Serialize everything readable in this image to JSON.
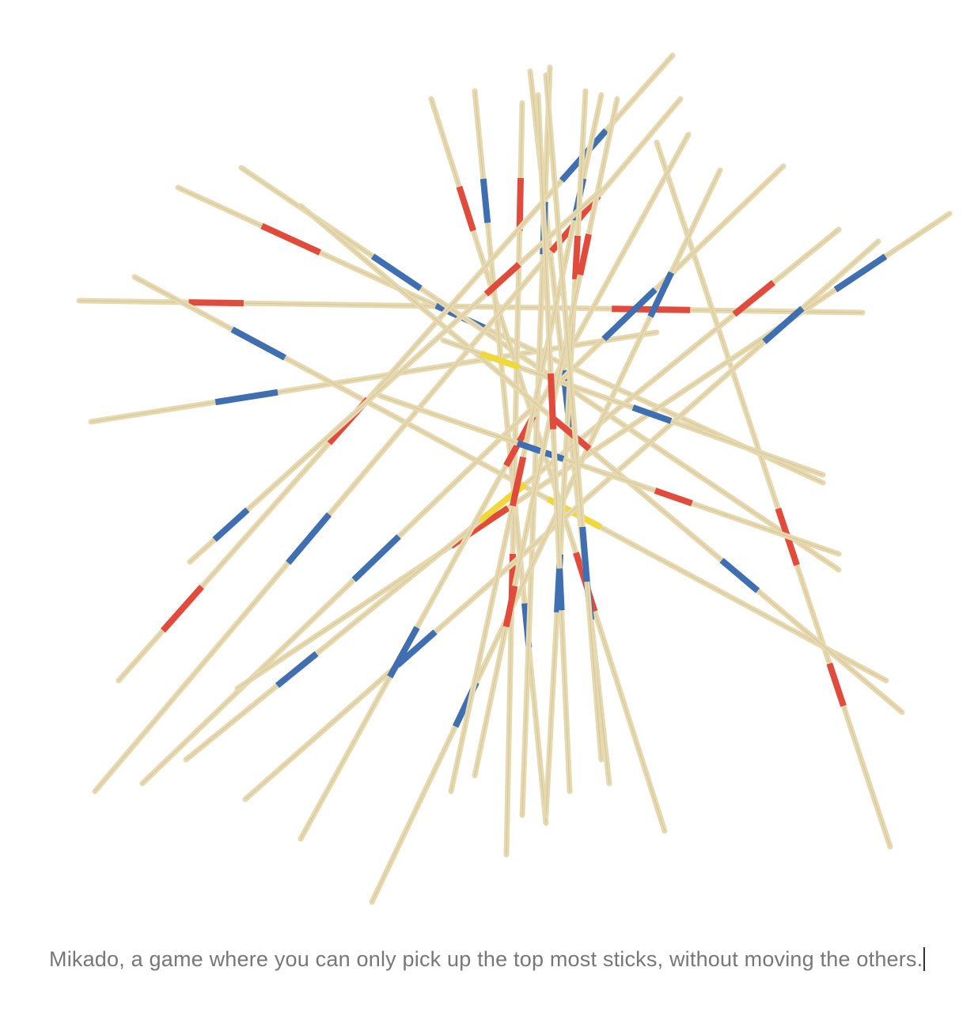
{
  "image": {
    "alt": "Mikado pick-up sticks scattered",
    "stick_wood_color": "#e6d9b0",
    "band_colors": {
      "red": "#e04b3c",
      "blue": "#3f6fb0",
      "yellow": "#f0d83a"
    }
  },
  "caption": {
    "text": "Mikado, a game where you can only pick up the top most sticks, without moving the others."
  }
}
